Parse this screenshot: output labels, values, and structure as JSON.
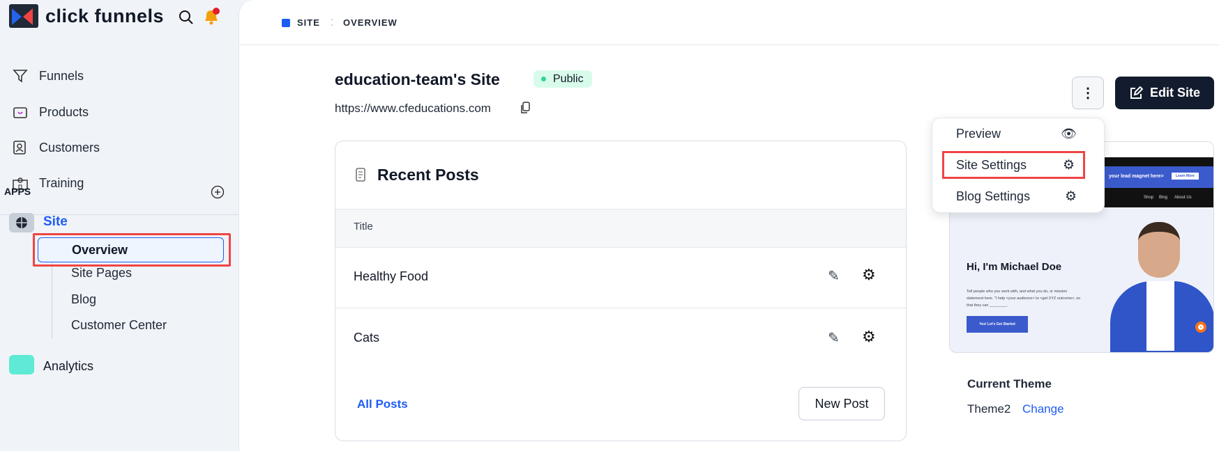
{
  "brand": {
    "name": "click funnels"
  },
  "sidebar": {
    "nav": [
      {
        "label": "Funnels",
        "icon": "funnel-icon"
      },
      {
        "label": "Products",
        "icon": "product-box-icon"
      },
      {
        "label": "Customers",
        "icon": "contact-card-icon"
      },
      {
        "label": "Training",
        "icon": "school-building-icon"
      }
    ],
    "apps_label": "APPS",
    "site_label": "Site",
    "sub_items": [
      "Overview",
      "Site Pages",
      "Blog",
      "Customer Center"
    ],
    "analytics_label": "Analytics"
  },
  "breadcrumb": [
    "SITE",
    "OVERVIEW"
  ],
  "site": {
    "title": "education-team's Site",
    "status": "Public",
    "url": "https://www.cfeducations.com"
  },
  "posts": {
    "heading": "Recent Posts",
    "column": "Title",
    "rows": [
      "Healthy Food",
      "Cats"
    ],
    "all_posts": "All Posts",
    "new_post": "New Post"
  },
  "actions": {
    "edit_site": "Edit Site"
  },
  "menu": [
    "Preview",
    "Site Settings",
    "Blog Settings"
  ],
  "preview": {
    "hero_title": "Hi, I'm Michael Doe",
    "hero_text": "Tell people who you work with, and what you do, or mission statement here. \"I help <your audience> to <get XYZ outcome>, so that they can ________.",
    "cta": "Yes! Let's Get Started",
    "banner": "your lead magnet here>",
    "banner_btn": "Learn More",
    "nav": [
      "Shop",
      "Blog",
      "About Us"
    ]
  },
  "theme": {
    "label": "Current Theme",
    "name": "Theme2",
    "change": "Change"
  },
  "colors": {
    "accent": "#1d5cf5",
    "dark": "#131c2e",
    "public_bg": "#d9fbeb",
    "highlight": "#ef4444"
  }
}
